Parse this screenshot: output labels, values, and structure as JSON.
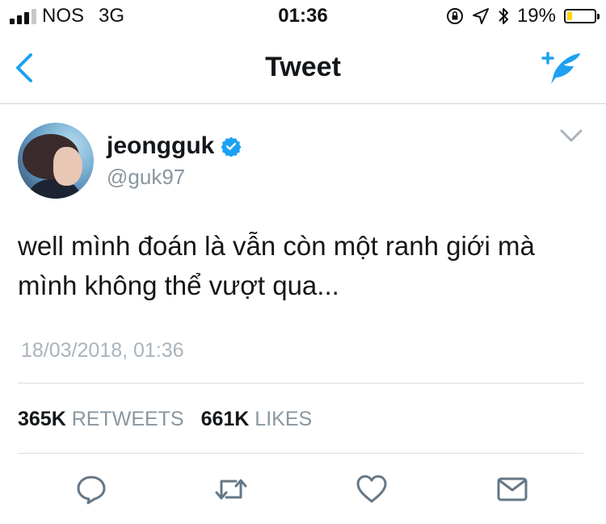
{
  "status_bar": {
    "carrier": "NOS",
    "network": "3G",
    "time": "01:36",
    "battery_percent": "19%",
    "battery_level": 0.19,
    "signal_bars_filled": 3,
    "signal_bars_total": 4,
    "icons": [
      "rotation-lock-icon",
      "location-arrow-icon",
      "bluetooth-icon",
      "battery-icon"
    ]
  },
  "nav": {
    "title": "Tweet",
    "back_icon": "chevron-left-icon",
    "compose_icon": "compose-quill-icon"
  },
  "tweet": {
    "author": {
      "display_name": "jeongguk",
      "handle": "@guk97",
      "verified": true
    },
    "text": "well mình đoán là vẫn còn một ranh giới mà mình không thể vượt qua...",
    "timestamp": "18/03/2018, 01:36",
    "stats": {
      "retweets_count": "365K",
      "retweets_label": "RETWEETS",
      "likes_count": "661K",
      "likes_label": "LIKES"
    },
    "actions": [
      "reply-icon",
      "retweet-icon",
      "like-icon",
      "direct-message-icon"
    ]
  },
  "colors": {
    "accent": "#1da1f2",
    "battery_fill": "#ffd400",
    "muted_text": "#8a969f",
    "timestamp_text": "#aab4bc"
  }
}
